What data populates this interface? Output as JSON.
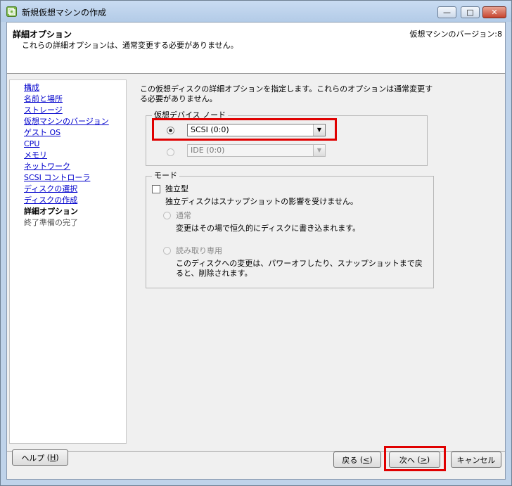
{
  "window": {
    "title": "新規仮想マシンの作成",
    "controls": {
      "minimize": "—",
      "maximize": "□",
      "close": "✕"
    }
  },
  "header": {
    "title": "詳細オプション",
    "subtitle": "これらの詳細オプションは、通常変更する必要がありません。",
    "version_label": "仮想マシンのバージョン:",
    "version_value": "8"
  },
  "nav": {
    "items": [
      {
        "label": "構成",
        "state": "link"
      },
      {
        "label": "名前と場所",
        "state": "link"
      },
      {
        "label": "ストレージ",
        "state": "link"
      },
      {
        "label": "仮想マシンのバージョン",
        "state": "link"
      },
      {
        "label": "ゲスト OS",
        "state": "link"
      },
      {
        "label": "CPU",
        "state": "link"
      },
      {
        "label": "メモリ",
        "state": "link"
      },
      {
        "label": "ネットワーク",
        "state": "link"
      },
      {
        "label": "SCSI コントローラ",
        "state": "link"
      },
      {
        "label": "ディスクの選択",
        "state": "link"
      },
      {
        "label": "ディスクの作成",
        "state": "link"
      },
      {
        "label": "詳細オプション",
        "state": "current"
      },
      {
        "label": "終了準備の完了",
        "state": "disabled"
      }
    ]
  },
  "main": {
    "description": "この仮想ディスクの詳細オプションを指定します。これらのオプションは通常変更する必要がありません。",
    "device_node": {
      "legend": "仮想デバイス ノード",
      "scsi_value": "SCSI (0:0)",
      "ide_value": "IDE (0:0)"
    },
    "mode": {
      "legend": "モード",
      "independent_label": "独立型",
      "independent_desc": "独立ディスクはスナップショットの影響を受けません。",
      "persistent_label": "通常",
      "persistent_desc": "変更はその場で恒久的にディスクに書き込まれます。",
      "nonpersistent_label": "読み取り専用",
      "nonpersistent_desc": "このディスクへの変更は、パワーオフしたり、スナップショットまで戻ると、削除されます。"
    }
  },
  "buttons": {
    "help": "ヘルプ",
    "help_key": "H",
    "back": "戻る",
    "back_key": "<",
    "next": "次へ",
    "next_key": ">",
    "cancel": "キャンセル"
  },
  "colors": {
    "highlight": "#e00000",
    "link": "#0000cc"
  }
}
